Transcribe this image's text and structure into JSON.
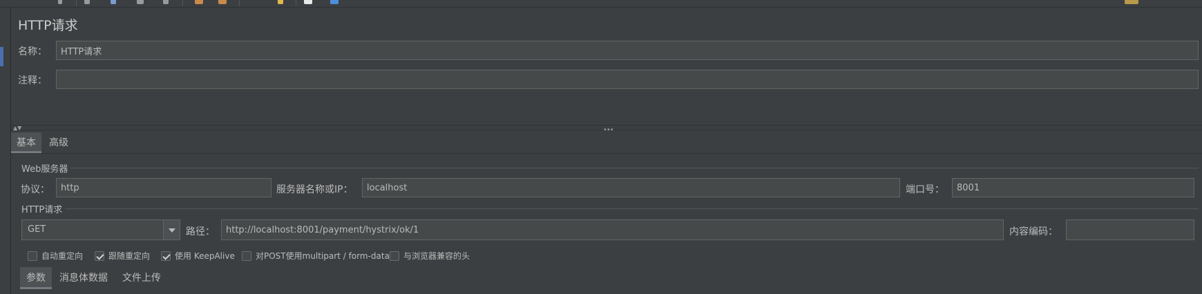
{
  "panel_title": "HTTP请求",
  "form": {
    "name_label": "名称：",
    "name_value": "HTTP请求",
    "comment_label": "注释：",
    "comment_value": ""
  },
  "tabs": [
    {
      "label": "基本",
      "active": true
    },
    {
      "label": "高级",
      "active": false
    }
  ],
  "web_server": {
    "title": "Web服务器",
    "protocol_label": "协议：",
    "protocol_value": "http",
    "server_label": "服务器名称或IP：",
    "server_value": "localhost",
    "port_label": "端口号：",
    "port_value": "8001"
  },
  "http_request": {
    "title": "HTTP请求",
    "method": "GET",
    "path_label": "路径：",
    "path_value": "http://localhost:8001/payment/hystrix/ok/1",
    "encoding_label": "内容编码：",
    "encoding_value": ""
  },
  "options": [
    {
      "label": "自动重定向",
      "checked": false
    },
    {
      "label": "跟随重定向",
      "checked": true
    },
    {
      "label": "使用 KeepAlive",
      "checked": true
    },
    {
      "label": "对POST使用multipart / form-data",
      "checked": false
    },
    {
      "label": "与浏览器兼容的头",
      "checked": false
    }
  ],
  "sub_tabs": [
    {
      "label": "参数",
      "active": true
    },
    {
      "label": "消息体数据",
      "active": false
    },
    {
      "label": "文件上传",
      "active": false
    }
  ],
  "colors": {
    "background": "#3c3f41",
    "field_bg": "#45494a",
    "field_border": "#646464",
    "text": "#bbbbbb",
    "selection_accent": "#4b6eaf"
  }
}
